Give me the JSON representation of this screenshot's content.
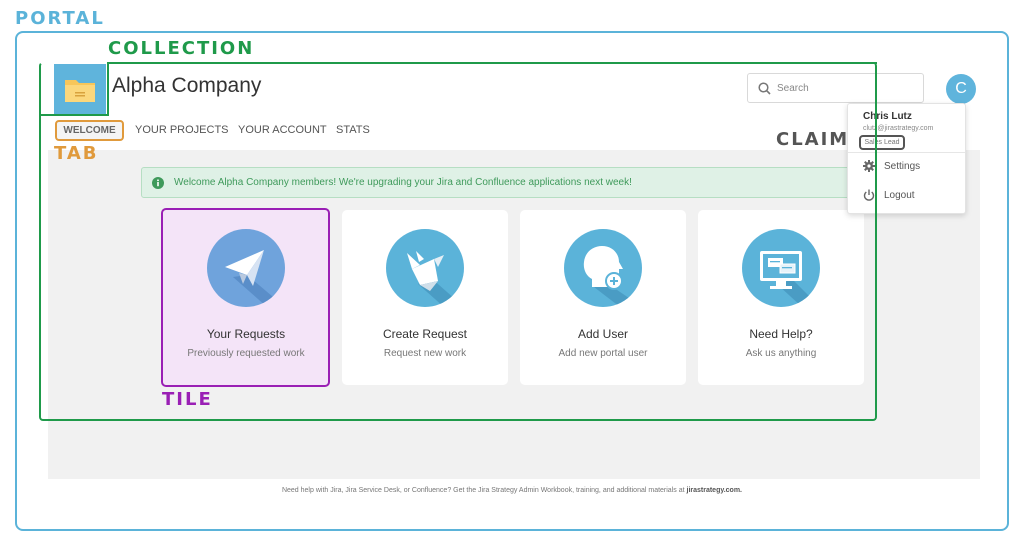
{
  "annotations": {
    "portal": "PORTAL",
    "collection": "COLLECTION",
    "tab": "TAB",
    "claim": "CLAIM",
    "tile": "TILE"
  },
  "header": {
    "company": "Alpha Company",
    "search_placeholder": "Search",
    "avatar_initial": "C"
  },
  "nav": {
    "tabs": [
      "WELCOME",
      "YOUR PROJECTS",
      "YOUR ACCOUNT",
      "STATS"
    ]
  },
  "banner": {
    "text": "Welcome Alpha Company members! We're upgrading your Jira and Confluence applications next week!"
  },
  "tiles": [
    {
      "title": "Your Requests",
      "subtitle": "Previously requested work"
    },
    {
      "title": "Create Request",
      "subtitle": "Request new work"
    },
    {
      "title": "Add User",
      "subtitle": "Add new portal user"
    },
    {
      "title": "Need Help?",
      "subtitle": "Ask us anything"
    }
  ],
  "user_menu": {
    "name": "Chris Lutz",
    "email": "clutz@jirastrategy.com",
    "role": "Sales Lead",
    "settings": "Settings",
    "logout": "Logout"
  },
  "footer": {
    "text": "Need help with Jira, Jira Service Desk, or Confluence? Get the Jira Strategy Admin Workbook, training, and additional materials at",
    "link": "jirastrategy.com."
  },
  "colors": {
    "portal": "#5bb3d9",
    "collection": "#1f9a4a",
    "tab": "#e09a3c",
    "claim": "#555555",
    "tile": "#9a1fb5",
    "accent": "#5fb4dc"
  }
}
